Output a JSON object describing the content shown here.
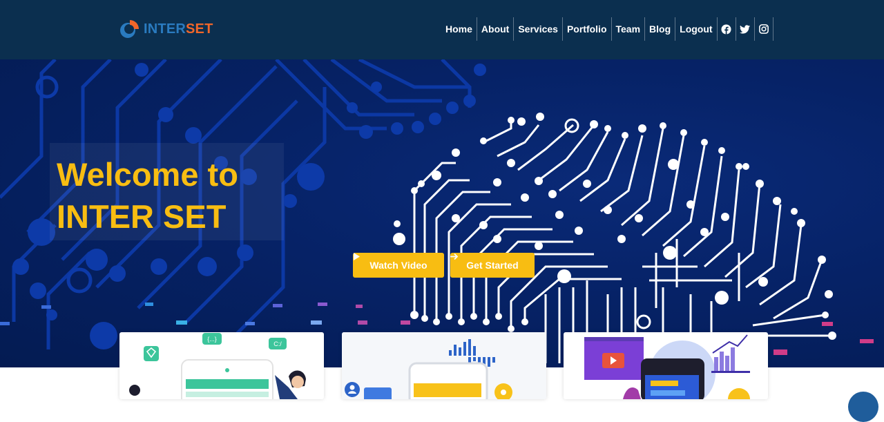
{
  "brand": {
    "name_part1": "INTER",
    "name_part2": "SET",
    "colors": {
      "blue": "#2a7bc0",
      "orange": "#f0662a"
    }
  },
  "nav": {
    "items": [
      "Home",
      "About",
      "Services",
      "Portfolio",
      "Team",
      "Blog",
      "Logout"
    ],
    "social_icons": [
      "facebook-icon",
      "twitter-icon",
      "instagram-icon"
    ]
  },
  "hero": {
    "title_line1": "Welcome to",
    "title_line2": "INTER SET",
    "watch_video_label": "Watch Video",
    "get_started_label": "Get Started",
    "accent_color": "#f8bd12",
    "background_color": "#062266"
  },
  "feature_cards": [
    {
      "illustration": "mobile-app-illustration",
      "tag_text_1": "{...}",
      "tag_text_2": "C:/"
    },
    {
      "illustration": "analytics-illustration"
    },
    {
      "illustration": "video-marketing-illustration"
    }
  ],
  "colors": {
    "navbar": "#0b2f4f"
  }
}
